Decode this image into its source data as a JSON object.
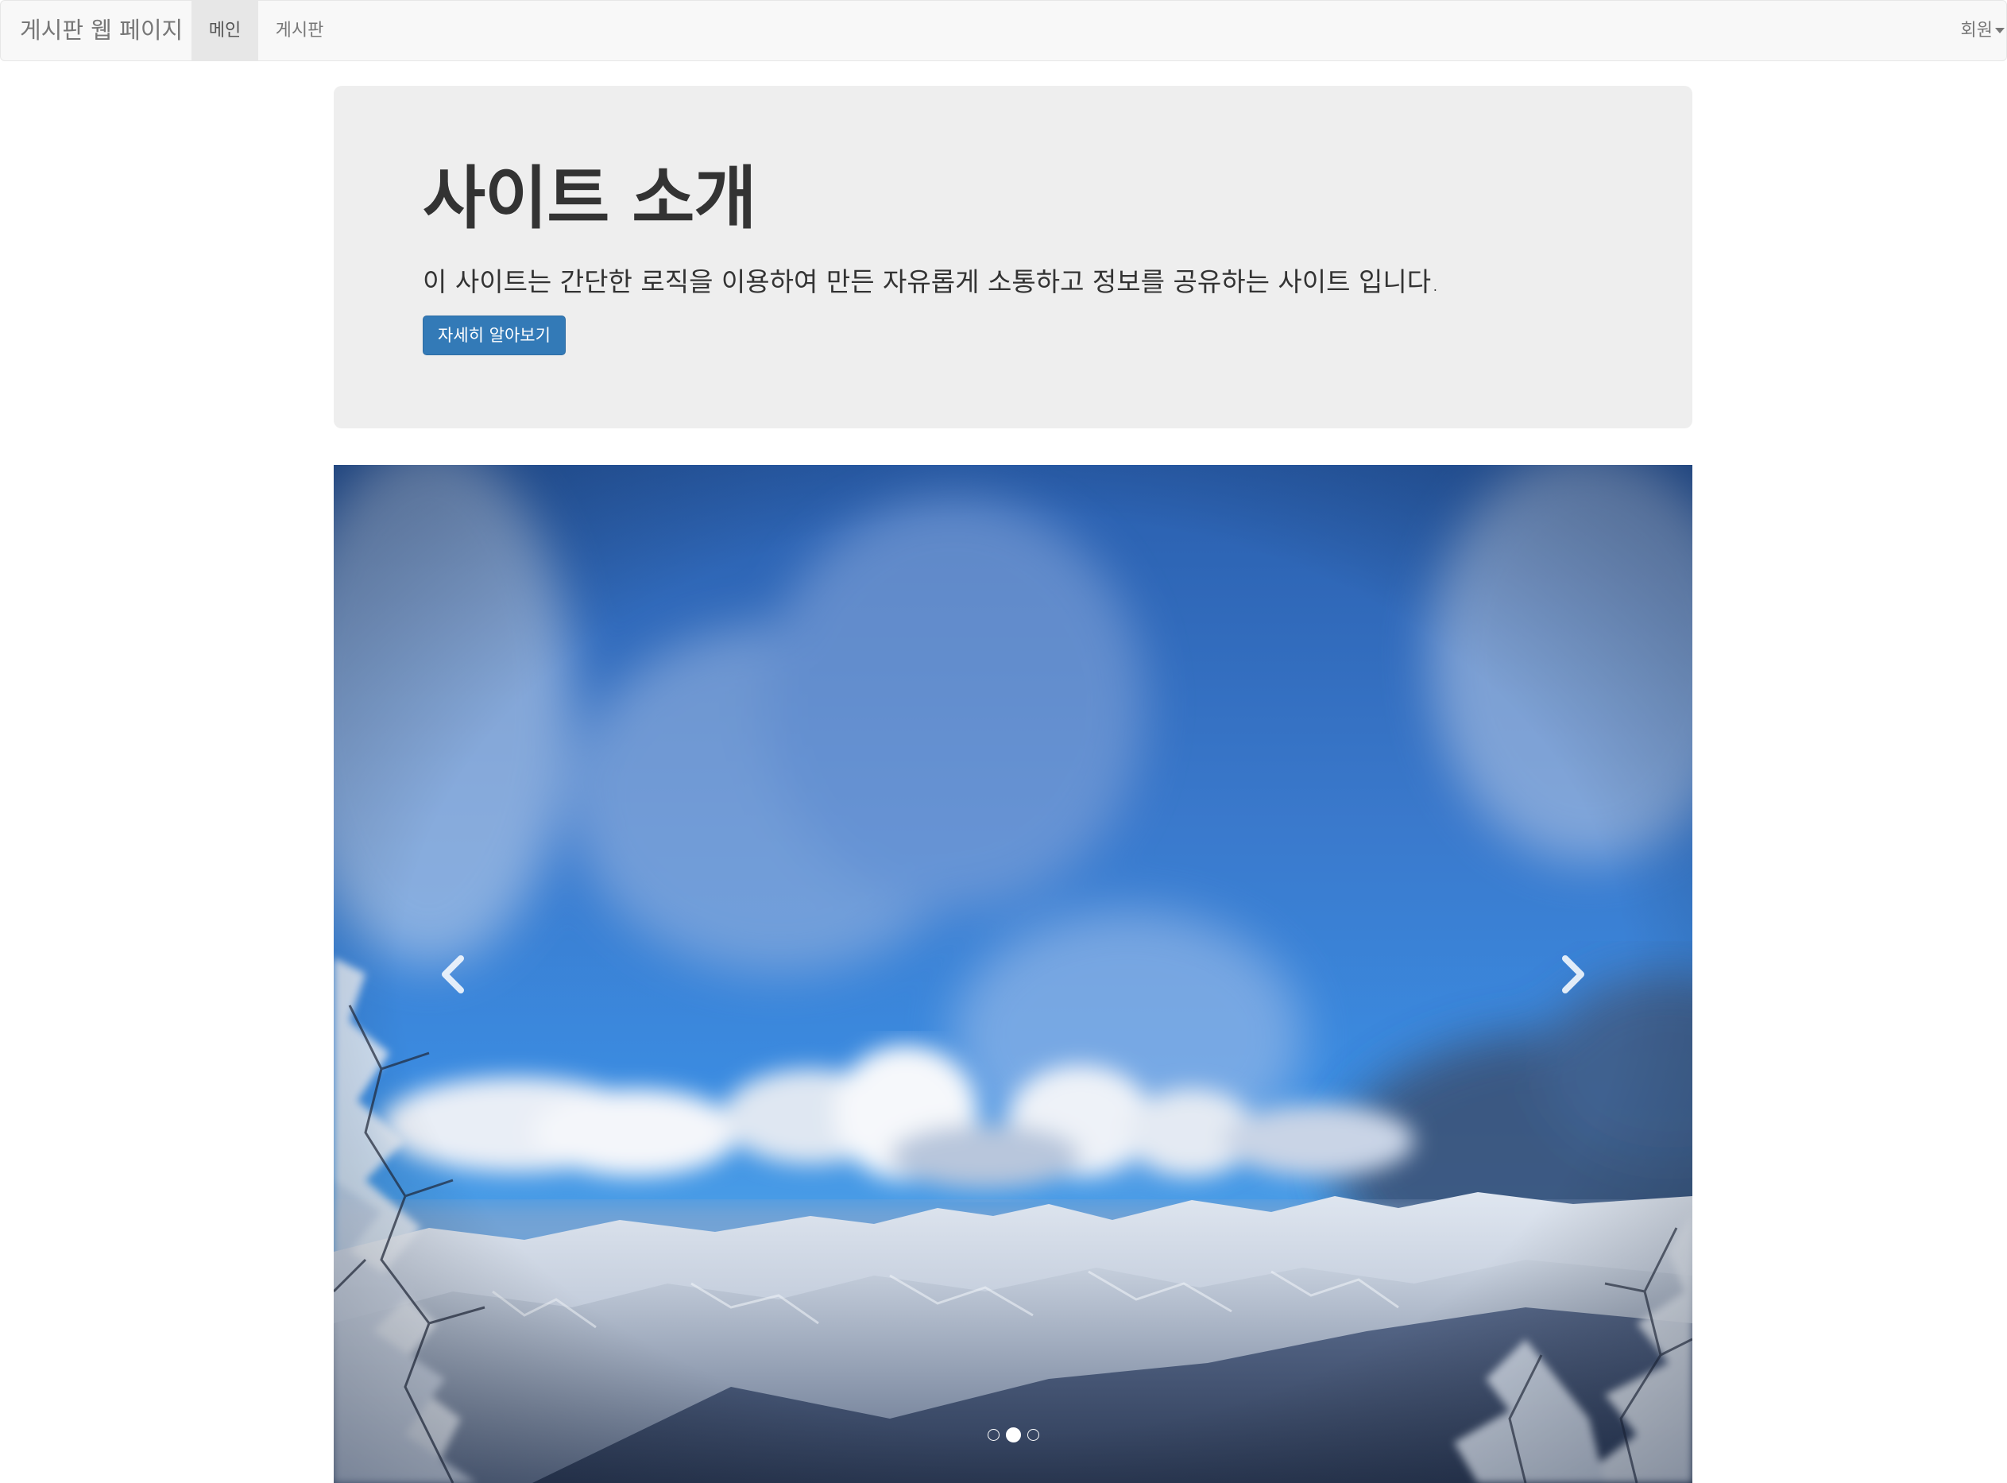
{
  "navbar": {
    "brand": "게시판 웹 페이지",
    "items": [
      {
        "label": "메인",
        "active": true
      },
      {
        "label": "게시판",
        "active": false
      }
    ],
    "member_menu": "회원"
  },
  "jumbotron": {
    "title": "사이트 소개",
    "description": "이 사이트는 간단한 로직을 이용하여 만든 자유롭게 소통하고 정보를 공유하는 사이트 입니다.",
    "button_label": "자세히 알아보기",
    "button_color": "#337ab7"
  },
  "carousel": {
    "slide_count": 3,
    "active_index": 1,
    "prev_icon": "chevron-left-icon",
    "next_icon": "chevron-right-icon",
    "image_description_icon": "snowy-mountain-landscape"
  }
}
